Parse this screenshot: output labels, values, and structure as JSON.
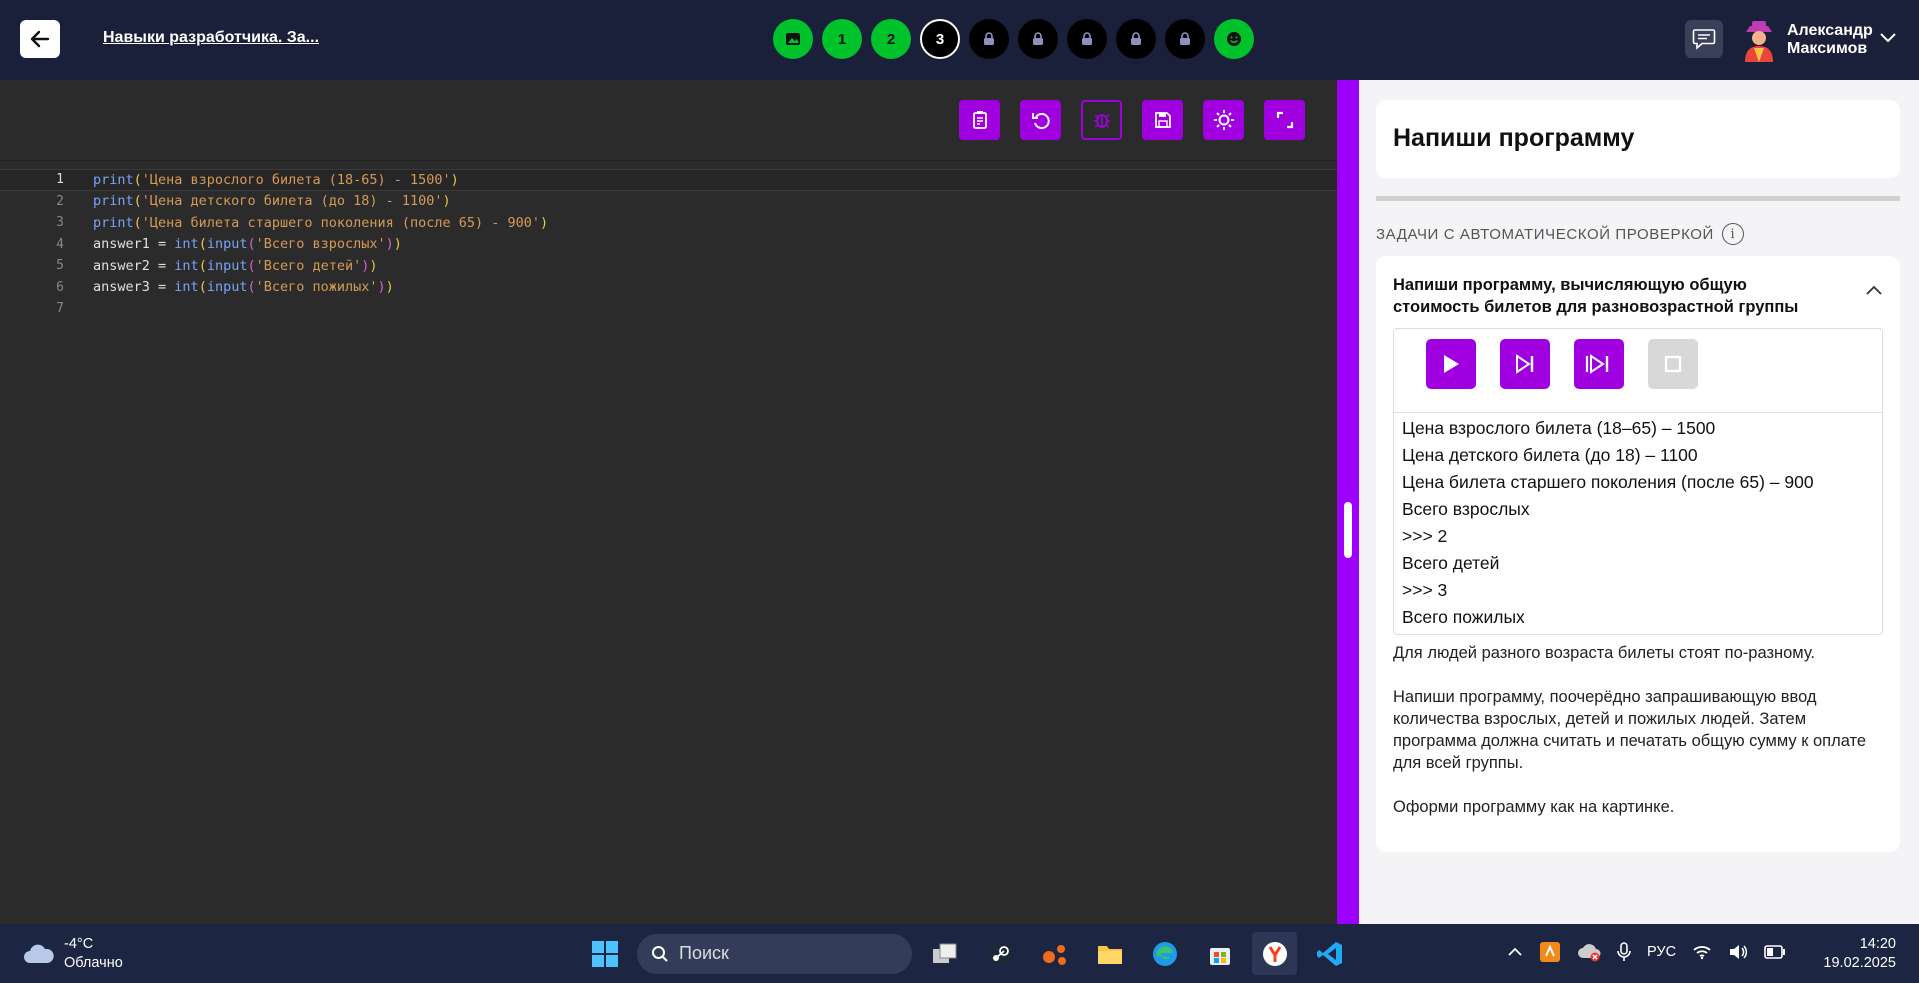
{
  "header": {
    "course_title": "Навыки разработчика. За...",
    "steps": [
      {
        "label": "",
        "state": "done",
        "icon": "image-icon"
      },
      {
        "label": "1",
        "state": "done"
      },
      {
        "label": "2",
        "state": "done"
      },
      {
        "label": "3",
        "state": "active"
      },
      {
        "label": "",
        "state": "locked",
        "icon": "lock-icon"
      },
      {
        "label": "",
        "state": "locked",
        "icon": "lock-icon"
      },
      {
        "label": "",
        "state": "locked",
        "icon": "lock-icon"
      },
      {
        "label": "",
        "state": "locked",
        "icon": "lock-icon"
      },
      {
        "label": "",
        "state": "locked",
        "icon": "lock-icon"
      },
      {
        "label": "",
        "state": "done",
        "icon": "smile-icon"
      }
    ],
    "user": {
      "first_name": "Александр",
      "last_name": "Максимов"
    }
  },
  "editor": {
    "toolbar": [
      "clipboard-icon",
      "undo-icon",
      "bug-icon",
      "save-icon",
      "theme-icon",
      "fullscreen-icon"
    ],
    "lines": [
      {
        "n": "1",
        "code": "print('Цена взрослого билета (18-65) - 1500')"
      },
      {
        "n": "2",
        "code": "print('Цена детского билета (до 18) - 1100')"
      },
      {
        "n": "3",
        "code": "print('Цена билета старшего поколения (после 65) - 900')"
      },
      {
        "n": "4",
        "code": "answer1 = int(input('Всего взрослых'))"
      },
      {
        "n": "5",
        "code": "answer2 = int(input('Всего детей'))"
      },
      {
        "n": "6",
        "code": "answer3 = int(input('Всего пожилых'))"
      },
      {
        "n": "7",
        "code": ""
      }
    ]
  },
  "panel": {
    "title": "Напиши программу",
    "section_label": "ЗАДАЧИ С АВТОМАТИЧЕСКОЙ ПРОВЕРКОЙ",
    "task_heading": "Напиши программу, вычисляющую общую стоимость билетов для разновозрастной группы",
    "console_lines": [
      "Цена взрослого билета (18–65) – 1500",
      "Цена детского билета (до 18) – 1100",
      "Цена билета старшего поколения (после 65) – 900",
      "Всего взрослых",
      ">>> 2",
      "Всего детей",
      ">>> 3",
      "Всего пожилых"
    ],
    "description": [
      "Для людей разного возраста билеты стоят по-разному.",
      "Напиши программу, поочерёдно запрашивающую ввод количества взрослых, детей и пожилых людей. Затем программа должна считать и печатать общую сумму к оплате для всей группы.",
      "Оформи программу как на картинке."
    ]
  },
  "taskbar": {
    "temperature": "-4°C",
    "weather": "Облачно",
    "search_placeholder": "Поиск",
    "language": "РУС",
    "time": "14:20",
    "date": "19.02.2025"
  },
  "colors": {
    "accent": "#a000e0",
    "done": "#00c22b",
    "header": "#1a1f3a"
  }
}
